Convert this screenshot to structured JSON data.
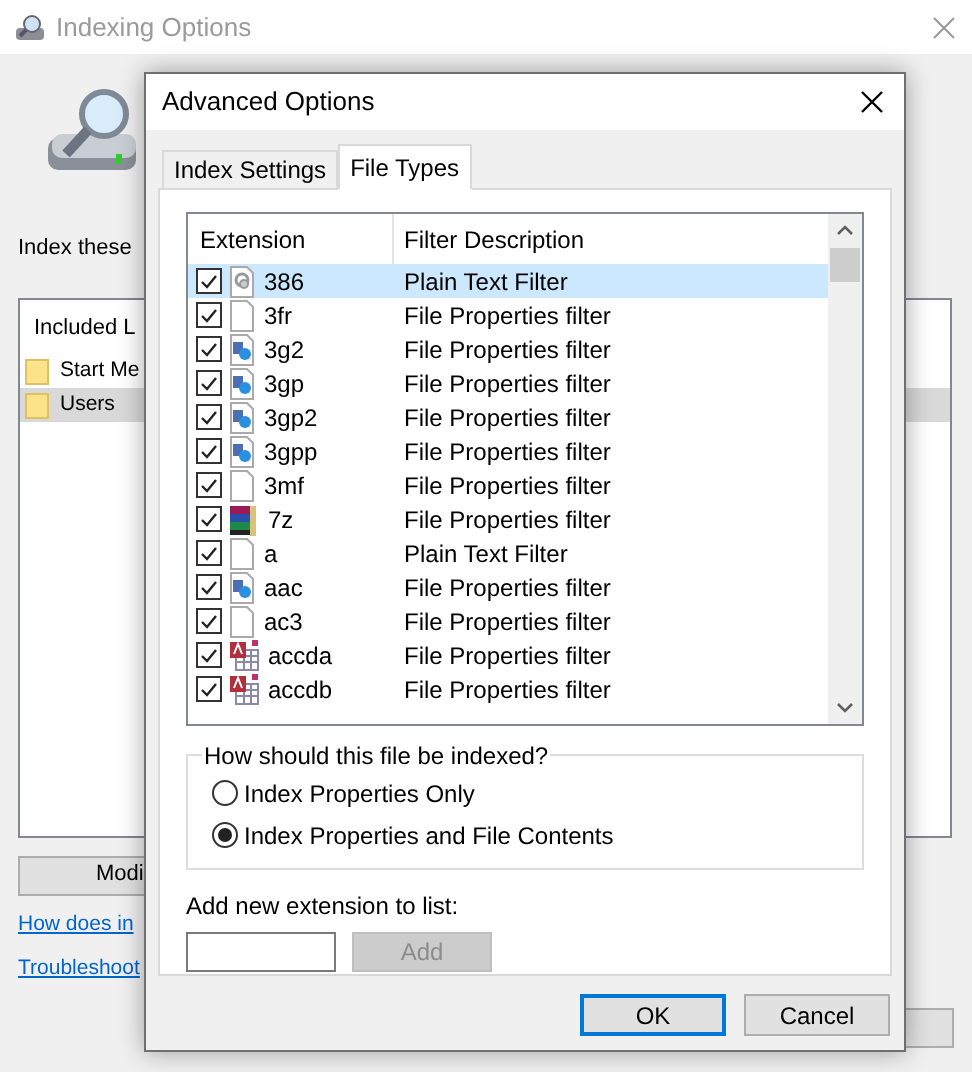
{
  "window": {
    "title": "Indexing Options"
  },
  "background": {
    "intro": "Index these",
    "list_header": "Included L",
    "locations": [
      {
        "name": "Start Me",
        "selected": false
      },
      {
        "name": "Users",
        "selected": true
      }
    ],
    "modify_button": "Modi",
    "links": [
      "How does in",
      "Troubleshoot"
    ]
  },
  "dialog": {
    "title": "Advanced Options",
    "tabs": [
      {
        "label": "Index Settings",
        "selected": false
      },
      {
        "label": "File Types",
        "selected": true
      }
    ],
    "table": {
      "columns": [
        "Extension",
        "Filter Description"
      ],
      "rows": [
        {
          "extension": "386",
          "filter": "Plain Text Filter",
          "kind": "gear",
          "checked": true,
          "selected": true
        },
        {
          "extension": "3fr",
          "filter": "File Properties filter",
          "kind": "blank",
          "checked": true,
          "selected": false
        },
        {
          "extension": "3g2",
          "filter": "File Properties filter",
          "kind": "media",
          "checked": true,
          "selected": false
        },
        {
          "extension": "3gp",
          "filter": "File Properties filter",
          "kind": "media",
          "checked": true,
          "selected": false
        },
        {
          "extension": "3gp2",
          "filter": "File Properties filter",
          "kind": "media",
          "checked": true,
          "selected": false
        },
        {
          "extension": "3gpp",
          "filter": "File Properties filter",
          "kind": "media",
          "checked": true,
          "selected": false
        },
        {
          "extension": "3mf",
          "filter": "File Properties filter",
          "kind": "blank",
          "checked": true,
          "selected": false
        },
        {
          "extension": "7z",
          "filter": "File Properties filter",
          "kind": "archive",
          "checked": true,
          "selected": false
        },
        {
          "extension": "a",
          "filter": "Plain Text Filter",
          "kind": "blank",
          "checked": true,
          "selected": false
        },
        {
          "extension": "aac",
          "filter": "File Properties filter",
          "kind": "media",
          "checked": true,
          "selected": false
        },
        {
          "extension": "ac3",
          "filter": "File Properties filter",
          "kind": "blank",
          "checked": true,
          "selected": false
        },
        {
          "extension": "accda",
          "filter": "File Properties filter",
          "kind": "database",
          "checked": true,
          "selected": false
        },
        {
          "extension": "accdb",
          "filter": "File Properties filter",
          "kind": "database",
          "checked": true,
          "selected": false
        }
      ]
    },
    "group": {
      "title": "How should this file be indexed?",
      "options": [
        {
          "label": "Index Properties Only",
          "selected": false
        },
        {
          "label": "Index Properties and File Contents",
          "selected": true
        }
      ]
    },
    "add_label": "Add new extension to list:",
    "add_button": {
      "label": "Add",
      "disabled": true
    },
    "buttons": [
      {
        "label": "OK",
        "default": true
      },
      {
        "label": "Cancel",
        "default": false
      }
    ]
  }
}
